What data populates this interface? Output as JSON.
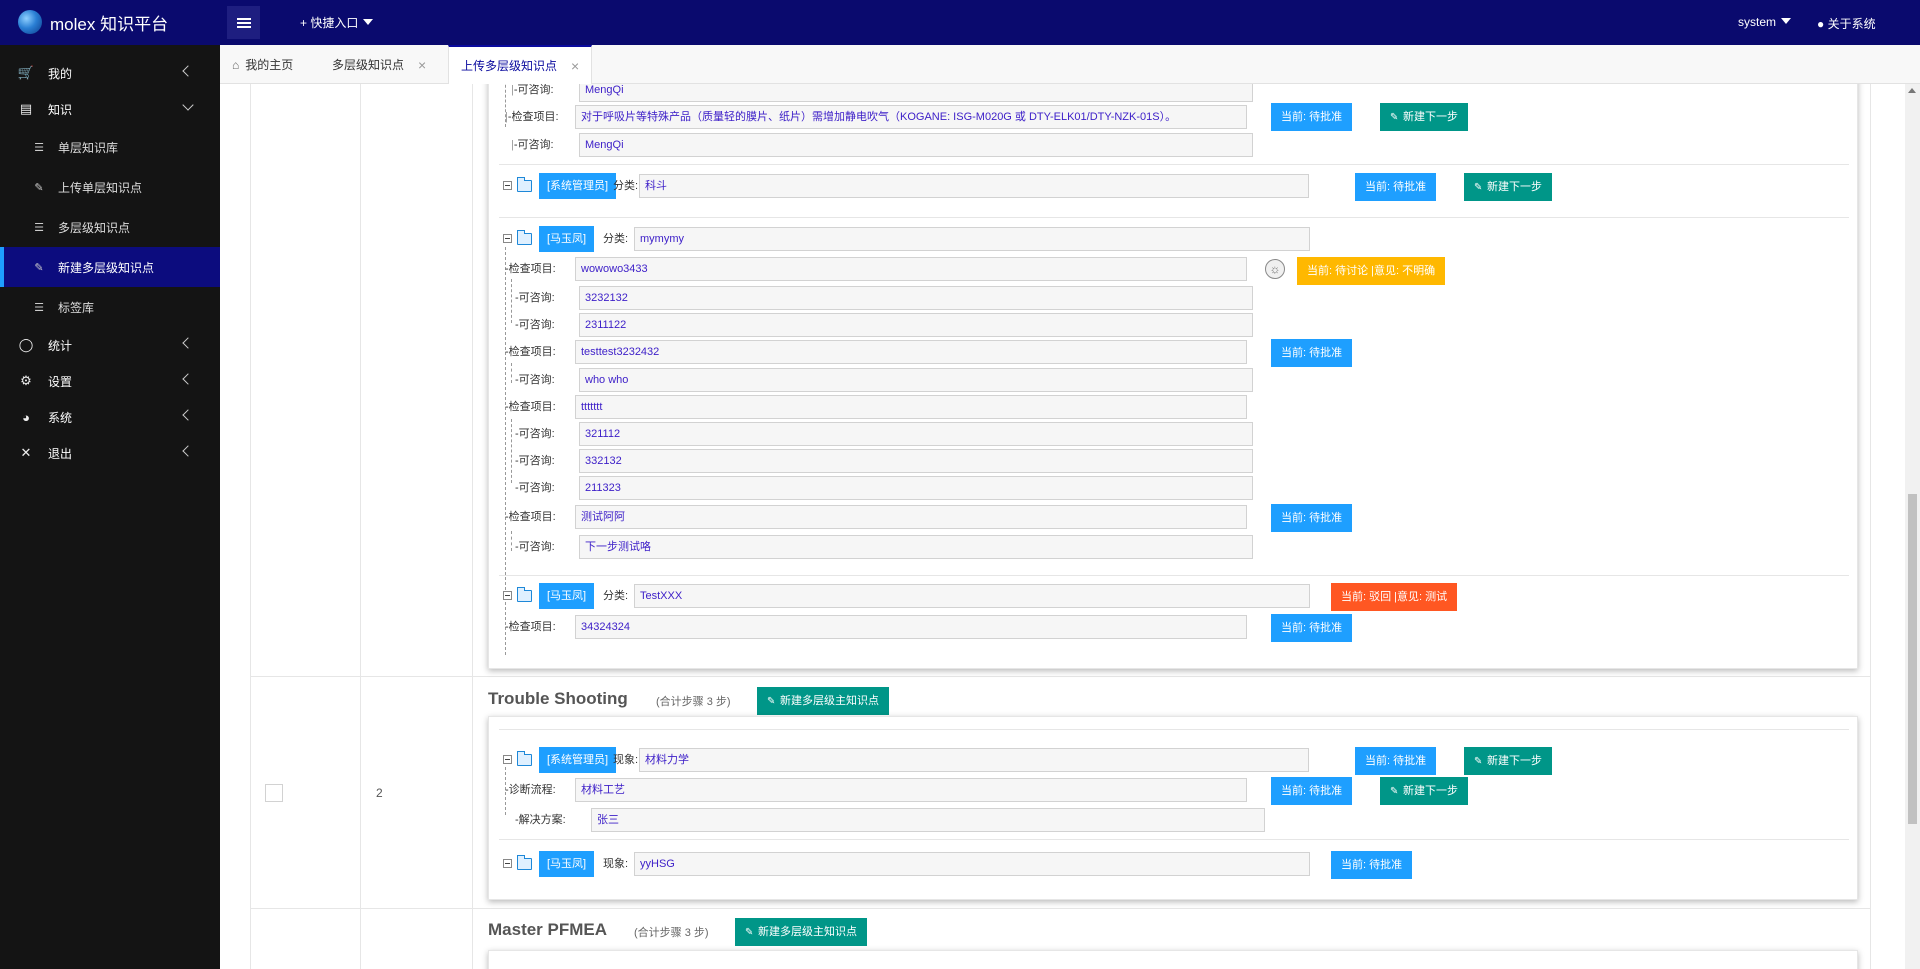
{
  "header": {
    "app_title": "molex 知识平台",
    "quick_entry": "+ 快捷入口",
    "user": "system",
    "about": "关于系统"
  },
  "sidebar": {
    "mine": "我的",
    "knowledge": "知识",
    "sub": [
      "单层知识库",
      "上传单层知识点",
      "多层级知识点",
      "新建多层级知识点",
      "标签库"
    ],
    "stats": "统计",
    "settings": "设置",
    "system": "系统",
    "logout": "退出"
  },
  "tabs": [
    {
      "label": "我的主页"
    },
    {
      "label": "多层级知识点"
    },
    {
      "label": "上传多层级知识点"
    }
  ],
  "labels": {
    "consult": "-可咨询:",
    "check": "-检查项目:",
    "category": "分类:",
    "phenomenon": "现象:",
    "diagnosis": "-诊断流程:",
    "solution": "-解决方案:",
    "pending": "当前: 待批准",
    "next_step": "新建下一步",
    "new_master": "新建多层级主知识点"
  },
  "card1": {
    "consult_top": "MengQi",
    "check_long": "对于呼吸片等特殊产品（质量轻的膜片、纸片）需增加静电吹气（KOGANE: ISG-M020G 或 DTY-ELK01/DTY-NZK-01S）。",
    "consult_2": "MengQi",
    "group_admin": {
      "role": "[系统管理员]",
      "category": "科斗"
    },
    "group_ma1": {
      "role": "[马玉凤]",
      "category": "mymymy",
      "items": [
        {
          "check": "wowowo3433",
          "consults": [
            "3232132",
            "2311122"
          ],
          "status": "当前: 待讨论 |意见: 不明确"
        },
        {
          "check": "testtest3232432",
          "consults": [
            "who who"
          ],
          "status": "当前: 待批准"
        },
        {
          "check": "ttttttt",
          "consults": [
            "321112",
            "332132",
            "211323"
          ],
          "status": ""
        },
        {
          "check": "测试阿阿",
          "consults": [
            "下一步测试咯"
          ],
          "status": "当前: 待批准"
        }
      ]
    },
    "group_ma2": {
      "role": "[马玉凤]",
      "category": "TestXXX",
      "status": "当前: 驳回 |意见: 测试",
      "check": "34324324"
    }
  },
  "section2": {
    "title": "Trouble Shooting",
    "count": "(合计步骤 3 步)",
    "row_number": "2",
    "group_admin": {
      "role": "[系统管理员]",
      "phenomenon": "材料力学",
      "diagnosis": "材料工艺",
      "solution": "张三"
    },
    "group_ma": {
      "role": "[马玉凤]",
      "phenomenon": "yyHSG"
    }
  },
  "section3": {
    "title": "Master PFMEA",
    "count": "(合计步骤 3 步)"
  }
}
